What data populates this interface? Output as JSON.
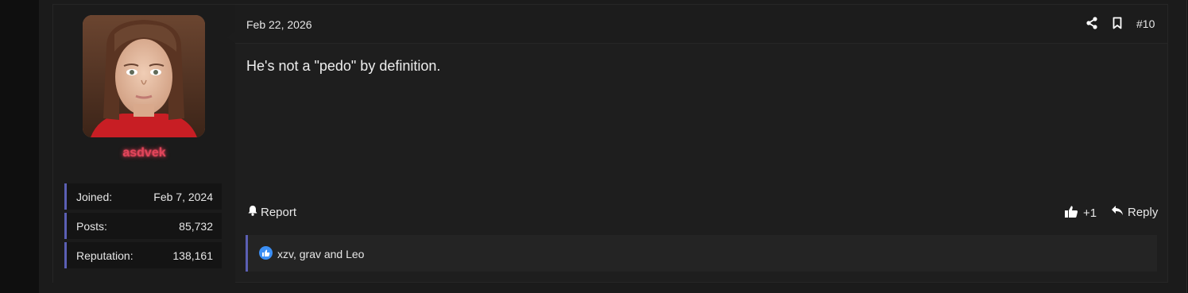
{
  "post": {
    "date": "Feb 22, 2026",
    "number": "#10",
    "body": "He's not a \"pedo\" by definition."
  },
  "user": {
    "name": "asdvek",
    "name_color": "#e0455a",
    "stats": [
      {
        "label": "Joined:",
        "value": "Feb 7, 2024"
      },
      {
        "label": "Posts:",
        "value": "85,732"
      },
      {
        "label": "Reputation:",
        "value": "138,161"
      }
    ]
  },
  "actions": {
    "report": "Report",
    "like": "+1",
    "reply": "Reply"
  },
  "reactions": {
    "text": "xzv, grav and Leo",
    "icon": "thumbs-up-icon",
    "icon_color": "#3b8ff5"
  },
  "icons": {
    "share": "share-icon",
    "bookmark": "bookmark-icon",
    "bell": "bell-icon",
    "thumb": "thumbs-up-icon",
    "reply": "reply-arrow-icon"
  },
  "colors": {
    "accent_border": "#5b5fb4"
  }
}
